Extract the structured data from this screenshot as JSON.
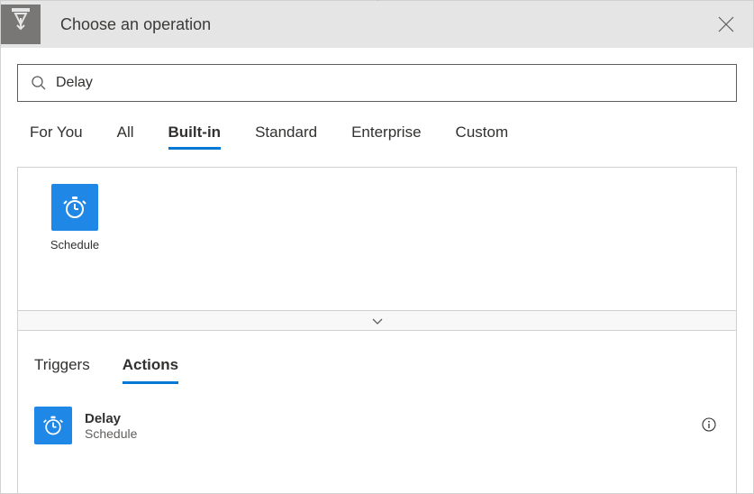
{
  "header": {
    "title": "Choose an operation"
  },
  "search": {
    "value": "Delay"
  },
  "tabs": [
    "For You",
    "All",
    "Built-in",
    "Standard",
    "Enterprise",
    "Custom"
  ],
  "active_tab": 2,
  "connectors": [
    {
      "label": "Schedule"
    }
  ],
  "sub_tabs": [
    "Triggers",
    "Actions"
  ],
  "active_sub_tab": 1,
  "actions": [
    {
      "title": "Delay",
      "subtitle": "Schedule"
    }
  ],
  "colors": {
    "accent": "#0078d4",
    "connector_bg": "#1f87e5",
    "header_icon_bg": "#797775"
  }
}
